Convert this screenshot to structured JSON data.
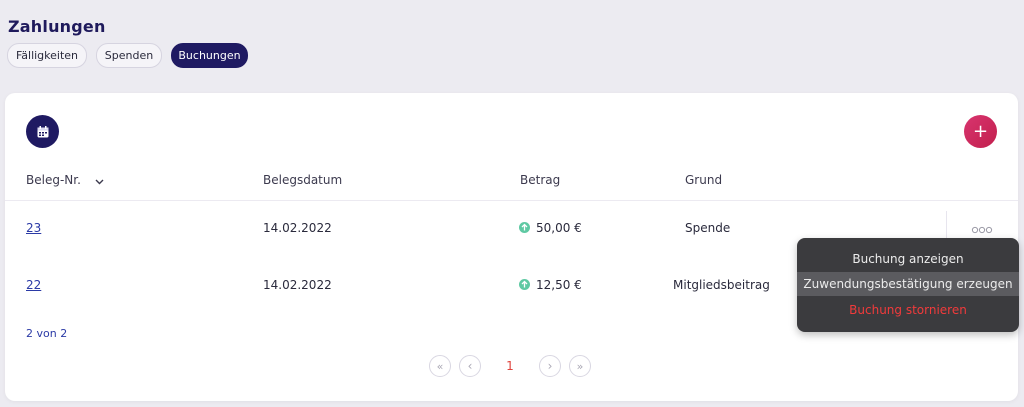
{
  "page": {
    "title": "Zahlungen"
  },
  "tabs": [
    {
      "label": "Fälligkeiten",
      "active": false
    },
    {
      "label": "Spenden",
      "active": false
    },
    {
      "label": "Buchungen",
      "active": true
    }
  ],
  "toolbar": {
    "calendar_icon": "calendar-icon",
    "add_label": "+"
  },
  "table": {
    "columns": [
      "Beleg-Nr.",
      "Belegsdatum",
      "Betrag",
      "Grund"
    ],
    "rows": [
      {
        "number": "23",
        "date": "14.02.2022",
        "amount": "50,00 €",
        "reason": "Spende"
      },
      {
        "number": "22",
        "date": "14.02.2022",
        "amount": "12,50 €",
        "reason": "Mitgliedsbeitrag"
      }
    ],
    "count_text": "2 von 2"
  },
  "pagination": {
    "first": "«",
    "prev": "‹",
    "current": "1",
    "next": "›",
    "last": "»"
  },
  "context_menu": {
    "items": [
      "Buchung anzeigen",
      "Zuwendungsbestätigung erzeugen",
      "Buchung stornieren"
    ]
  },
  "colors": {
    "brand": "#1f1a62",
    "accent": "#d8356f",
    "positive": "#5fc9a3",
    "danger": "#f13b3b"
  }
}
